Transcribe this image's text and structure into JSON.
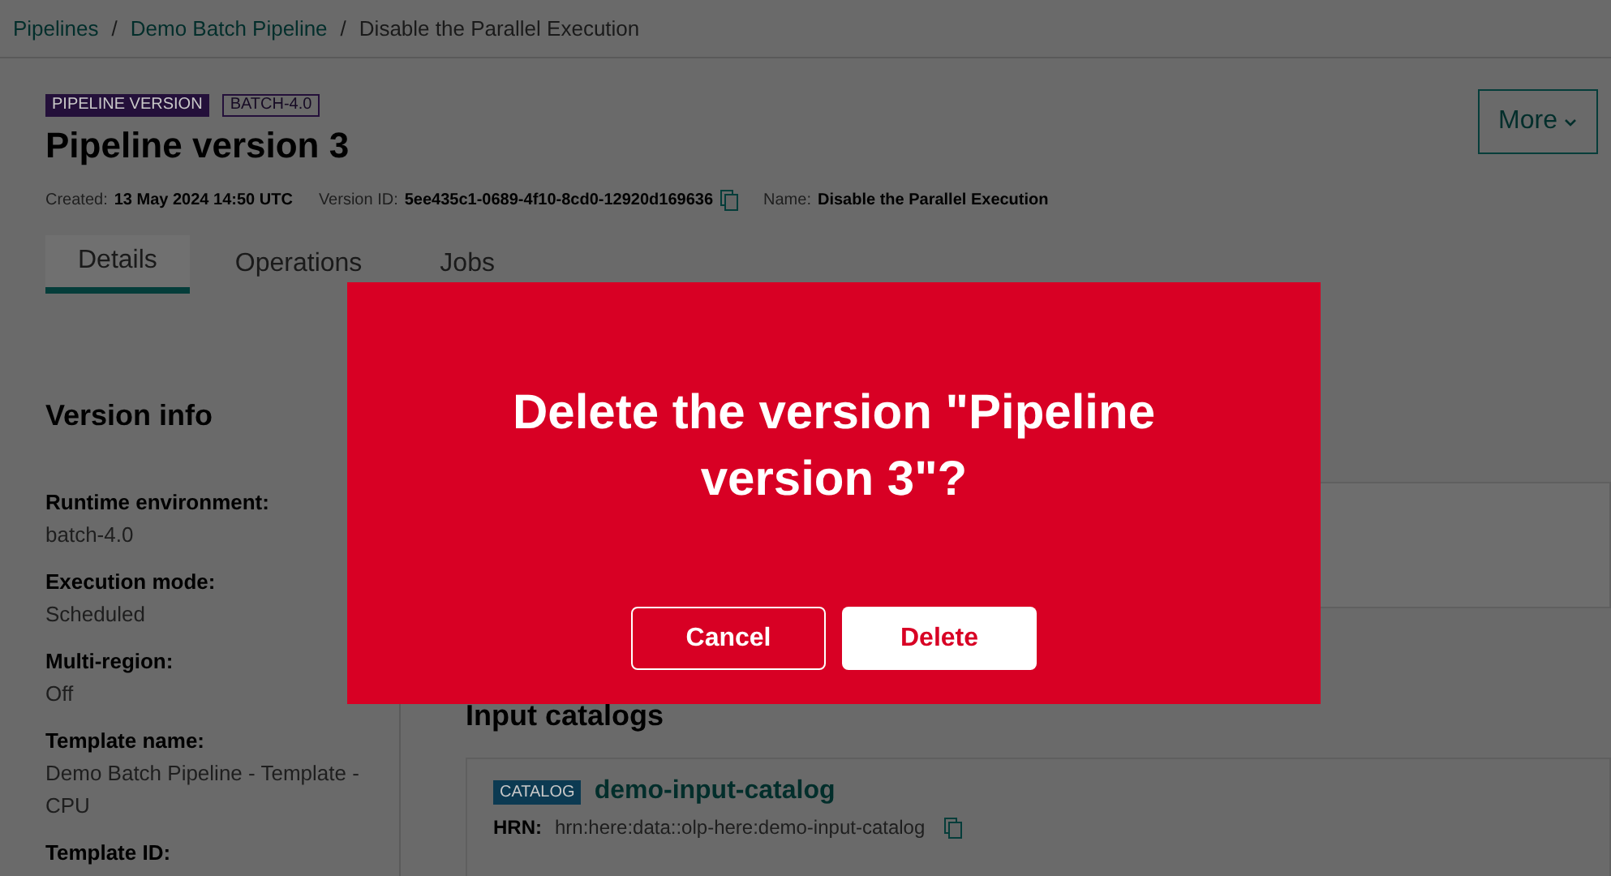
{
  "breadcrumb": [
    {
      "label": "Pipelines",
      "kind": "link"
    },
    {
      "separator": "/",
      "label": "Demo Batch Pipeline",
      "kind": "link"
    },
    {
      "separator": "/",
      "label": "Disable the Parallel Execution",
      "kind": "current"
    }
  ],
  "header": {
    "badges": [
      "PIPELINE VERSION",
      "BATCH-4.0"
    ],
    "title": "Pipeline version 3",
    "more_button": "More",
    "meta": [
      {
        "label": "Created:",
        "value": "13 May 2024 14:50 UTC",
        "copy": false
      },
      {
        "label": "Version ID:",
        "value": "5ee435c1-0689-4f10-8cd0-12920d169636",
        "copy": true
      },
      {
        "label": "Name:",
        "value": "Disable the Parallel Execution",
        "copy": false
      }
    ]
  },
  "tabs": [
    {
      "label": "Details",
      "selected": true
    },
    {
      "label": "Operations",
      "selected": false
    },
    {
      "label": "Jobs",
      "selected": false
    }
  ],
  "version_info": {
    "title": "Version info",
    "fields": [
      {
        "label": "Runtime environment:",
        "value": "batch-4.0"
      },
      {
        "label": "Execution mode:",
        "value": "Scheduled"
      },
      {
        "label": "Multi-region:",
        "value": "Off"
      },
      {
        "label": "Template name:",
        "value": "Demo Batch Pipeline - Template - CPU"
      },
      {
        "label": "Template ID:"
      }
    ]
  },
  "input_catalogs": {
    "title": "Input catalogs",
    "items": [
      {
        "badge": "CATALOG",
        "name": "demo-input-catalog",
        "hrn_label": "HRN:",
        "hrn": "hrn:here:data::olp-here:demo-input-catalog"
      }
    ]
  },
  "dialog": {
    "title": "Delete the version \"Pipeline version 3\"?",
    "buttons": [
      {
        "label": "Cancel",
        "kind": "secondary"
      },
      {
        "label": "Delete",
        "kind": "primary"
      }
    ]
  }
}
